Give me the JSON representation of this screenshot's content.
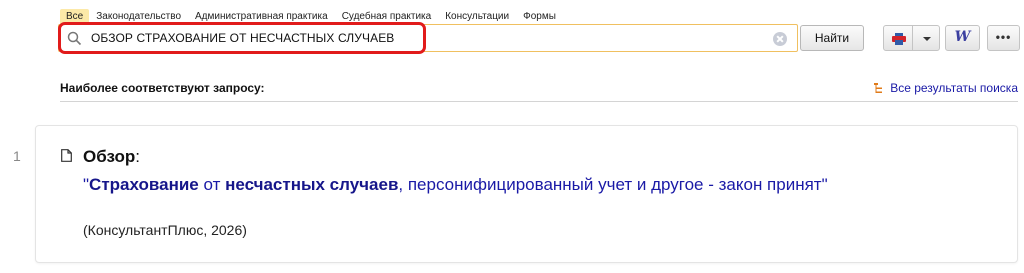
{
  "tabs": [
    "Все",
    "Законодательство",
    "Административная практика",
    "Судебная практика",
    "Консультации",
    "Формы"
  ],
  "search": {
    "value": "ОБЗОР СТРАХОВАНИЕ ОТ НЕСЧАСТНЫХ СЛУЧАЕВ",
    "icon": "search-icon"
  },
  "find_button": "Найти",
  "toolbar": {
    "print_icon": "printer-icon",
    "word_label": "W",
    "more_label": "•••"
  },
  "section": {
    "title": "Наиболее соответствуют запросу:",
    "all_results": "Все результаты поиска"
  },
  "results": [
    {
      "number": "1",
      "heading": "Обзор",
      "heading_suffix": ":",
      "link_parts": [
        "\"",
        "Страхование",
        " от ",
        "несчастных случаев",
        ", персонифицированный учет и другое - закон принят\""
      ],
      "source": "(КонсультантПлюс, 2026)"
    }
  ],
  "colors": {
    "link": "#1a1aa6",
    "highlight": "#e11b1b",
    "active_tab": "#fce9a8"
  }
}
